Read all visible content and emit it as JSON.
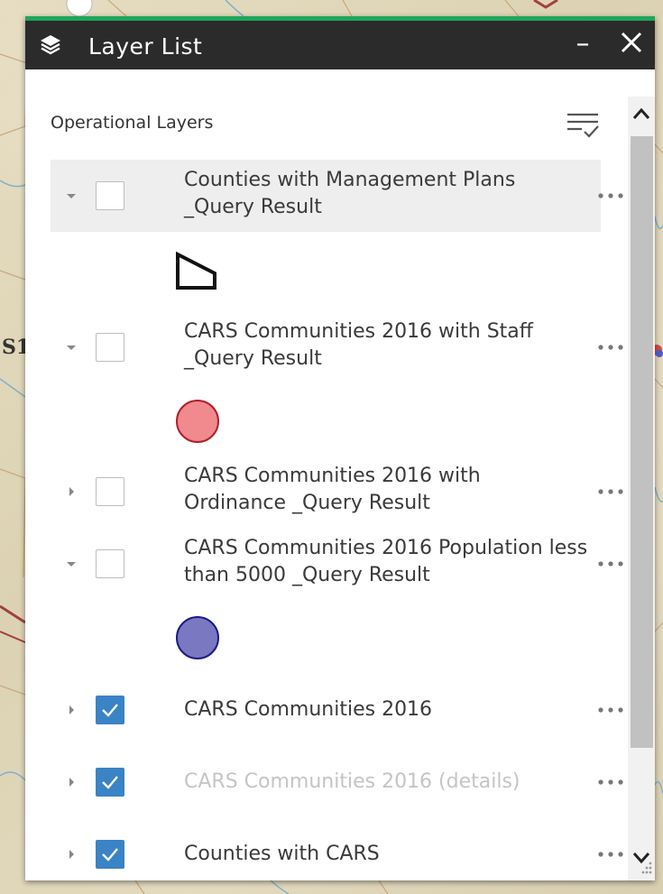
{
  "panel": {
    "title": "Layer List",
    "minimize_label": "–",
    "section_title": "Operational Layers"
  },
  "map": {
    "edge_label": "S1"
  },
  "layers": [
    {
      "title": "Counties with Management Plans _Query Result",
      "checked": false,
      "expanded": true,
      "dim": false,
      "legend": "polygon-outline"
    },
    {
      "title": "CARS Communities 2016 with Staff _Query Result",
      "checked": false,
      "expanded": true,
      "dim": false,
      "legend": "circle",
      "legend_color": "#f08a8f"
    },
    {
      "title": "CARS Communities 2016 with Ordinance _Query Result",
      "checked": false,
      "expanded": false,
      "dim": false
    },
    {
      "title": "CARS Communities 2016 Population less than 5000 _Query Result",
      "checked": false,
      "expanded": true,
      "dim": false,
      "legend": "circle",
      "legend_color": "#7b78c2"
    },
    {
      "title": "CARS Communities 2016",
      "checked": true,
      "expanded": false,
      "dim": false
    },
    {
      "title": "CARS Communities 2016 (details)",
      "checked": true,
      "expanded": false,
      "dim": true
    },
    {
      "title": "Counties with CARS",
      "checked": true,
      "expanded": false,
      "dim": false
    }
  ],
  "colors": {
    "header_bg": "#2b2b2b",
    "accent_line": "#1fa65a",
    "checkbox_checked": "#3a83c5",
    "row_highlight": "#eeeeee"
  }
}
